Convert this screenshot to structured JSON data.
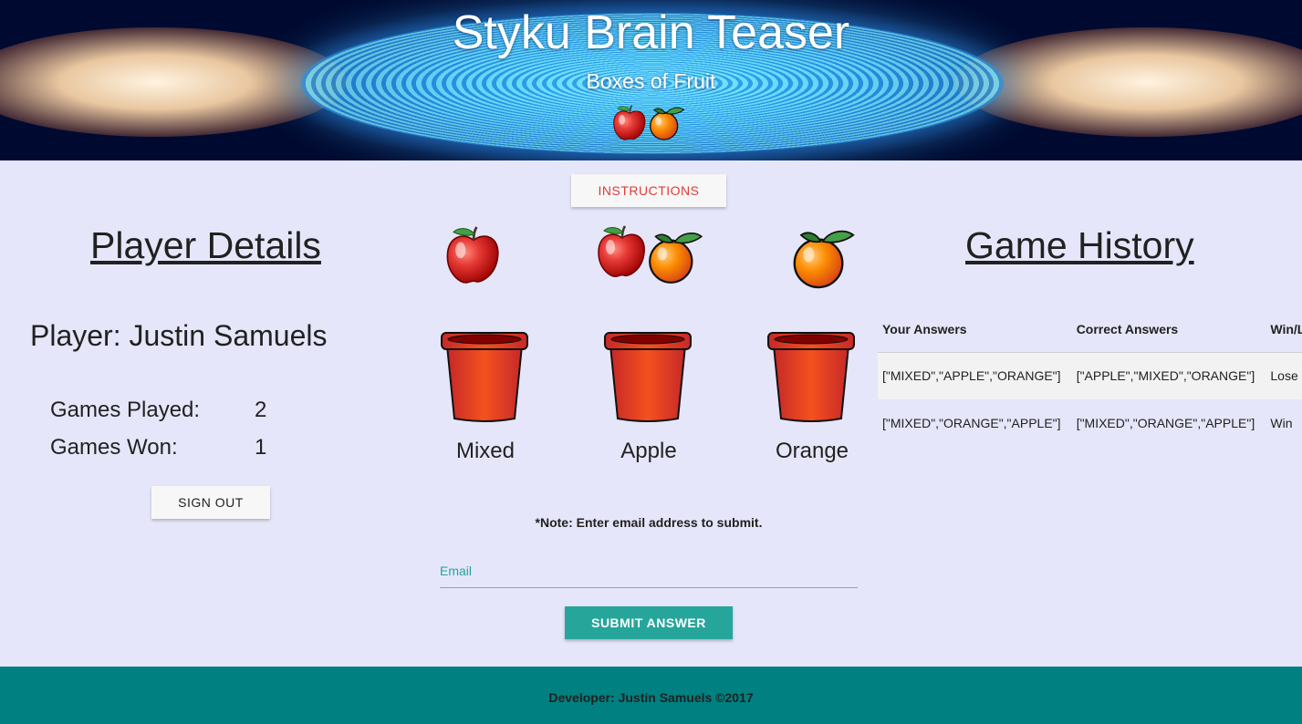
{
  "header": {
    "title": "Styku Brain Teaser",
    "subtitle": "Boxes of Fruit"
  },
  "instructions_label": "INSTRUCTIONS",
  "player": {
    "section_title": "Player Details",
    "name_line": "Player: Justin Samuels",
    "games_played_label": "Games Played:",
    "games_played": "2",
    "games_won_label": "Games Won:",
    "games_won": "1",
    "signout_label": "SIGN OUT"
  },
  "boxes": [
    {
      "label": "Mixed",
      "fruit": "apple-icon"
    },
    {
      "label": "Apple",
      "fruit": "apple-orange-icon"
    },
    {
      "label": "Orange",
      "fruit": "orange-icon"
    }
  ],
  "form": {
    "note": "*Note: Enter email address to submit.",
    "email_placeholder": "Email",
    "submit_label": "SUBMIT ANSWER"
  },
  "history": {
    "section_title": "Game History",
    "columns": [
      "Your Answers",
      "Correct Answers",
      "Win/Lose"
    ],
    "rows": [
      [
        "[\"MIXED\",\"APPLE\",\"ORANGE\"]",
        "[\"APPLE\",\"MIXED\",\"ORANGE\"]",
        "Lose"
      ],
      [
        "[\"MIXED\",\"ORANGE\",\"APPLE\"]",
        "[\"MIXED\",\"ORANGE\",\"APPLE\"]",
        "Win"
      ]
    ]
  },
  "footer": {
    "text": "Developer: Justin Samuels ©2017"
  },
  "colors": {
    "background": "#e6e6fa",
    "accent": "#26a69a",
    "footer": "#008080",
    "instructions_text": "#e53935",
    "box": "#e8492a"
  }
}
